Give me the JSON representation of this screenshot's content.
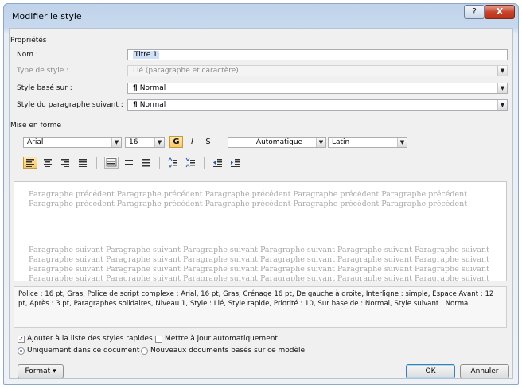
{
  "window": {
    "title": "Modifier le style",
    "help_label": "?",
    "close_label": "X"
  },
  "sections": {
    "properties": "Propriétés",
    "formatting": "Mise en forme"
  },
  "properties": {
    "name_label": "Nom :",
    "name_value": "Titre 1",
    "style_type_label": "Type de style :",
    "style_type_value": "Lié (paragraphe et caractère)",
    "based_on_label": "Style basé sur :",
    "based_on_value": "Normal",
    "next_style_label": "Style du paragraphe suivant :",
    "next_style_value": "Normal",
    "paragraph_mark": "¶"
  },
  "font": {
    "family": "Arial",
    "size": "16",
    "bold_label": "G",
    "italic_label": "I",
    "underline_label": "S",
    "color": "Automatique",
    "script": "Latin"
  },
  "preview": {
    "previous_text": "Paragraphe précédent Paragraphe précédent Paragraphe précédent Paragraphe précédent Paragraphe précédent Paragraphe précédent Paragraphe précédent Paragraphe précédent Paragraphe précédent Paragraphe précédent",
    "next_text": "Paragraphe suivant Paragraphe suivant Paragraphe suivant Paragraphe suivant Paragraphe suivant Paragraphe suivant Paragraphe suivant Paragraphe suivant Paragraphe suivant Paragraphe suivant Paragraphe suivant Paragraphe suivant Paragraphe suivant Paragraphe suivant Paragraphe suivant Paragraphe suivant Paragraphe suivant Paragraphe suivant Paragraphe suivant Paragraphe suivant Paragraphe suivant Paragraphe suivant Paragraphe suivant Paragraphe suivant"
  },
  "description": "Police : 16 pt, Gras, Police de script complexe : Arial, 16 pt, Gras, Crénage 16 pt, De gauche à droite, Interligne : simple, Espace Avant : 12 pt, Après : 3 pt, Paragraphes solidaires, Niveau 1, Style : Lié, Style rapide, Priorité : 10, Sur base de : Normal, Style suivant : Normal",
  "options": {
    "add_quick_styles": {
      "label": "Ajouter à la liste des styles rapides",
      "checked": true,
      "mark": "✓"
    },
    "auto_update": {
      "label": "Mettre à jour automatiquement",
      "checked": false
    },
    "only_this_document": {
      "label": "Uniquement dans ce document",
      "selected": true
    },
    "new_documents": {
      "label": "Nouveaux documents basés sur ce modèle",
      "selected": false
    }
  },
  "buttons": {
    "format": "Format ▾",
    "ok": "OK",
    "cancel": "Annuler"
  }
}
